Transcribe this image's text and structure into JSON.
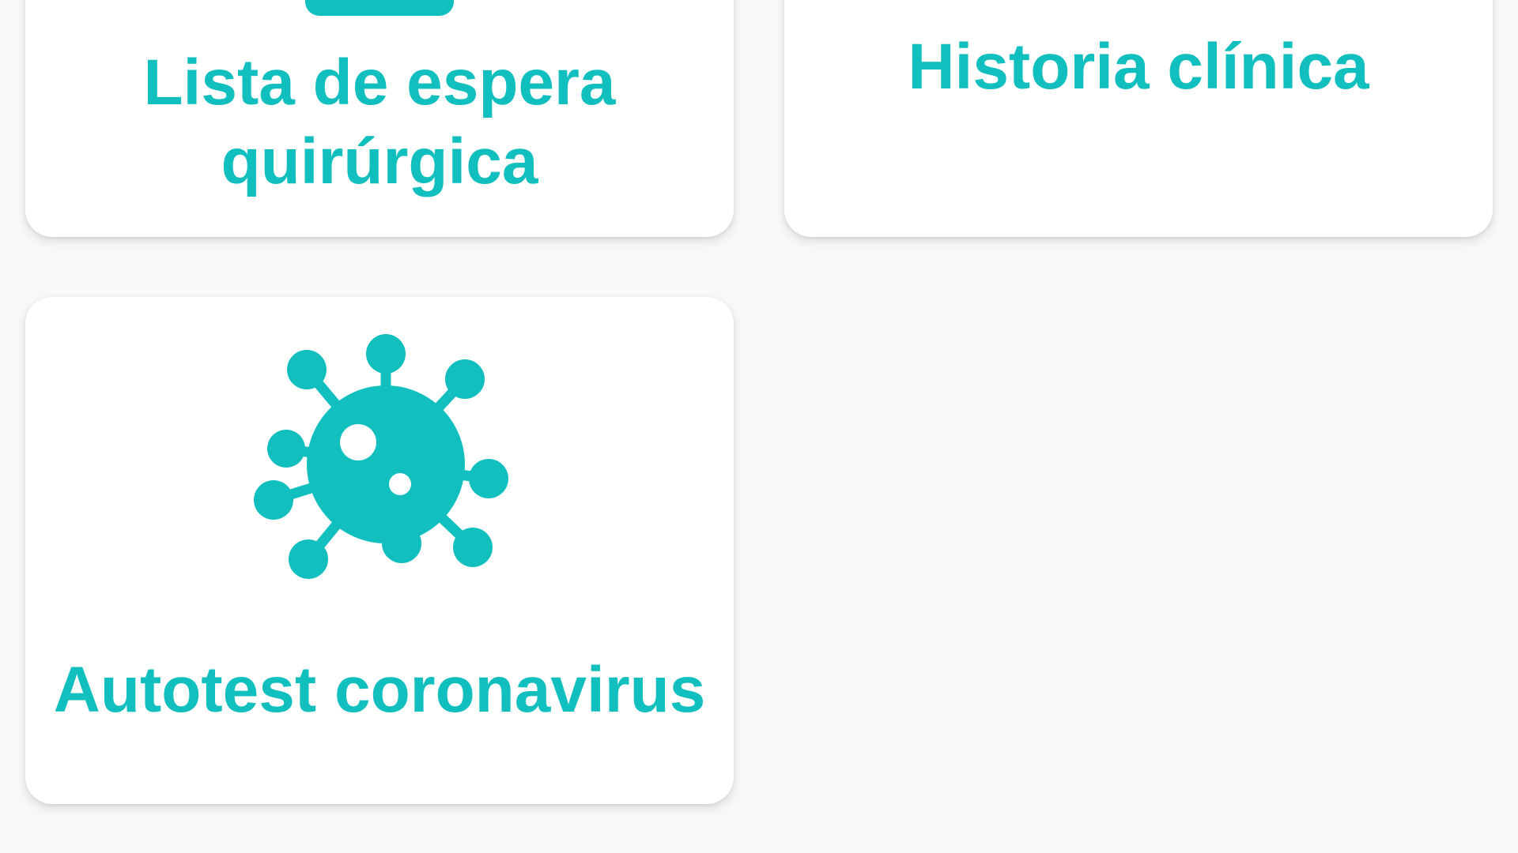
{
  "theme": {
    "accent": "#12BFBF",
    "background": "#F8F8F8",
    "card": "#FFFFFF"
  },
  "cards": [
    {
      "label": "Lista de espera\nquirúrgica",
      "icon": "clipboard-icon"
    },
    {
      "label": "Historia clínica",
      "icon": ""
    },
    {
      "label": "Autotest coronavirus",
      "icon": "virus-icon"
    }
  ]
}
